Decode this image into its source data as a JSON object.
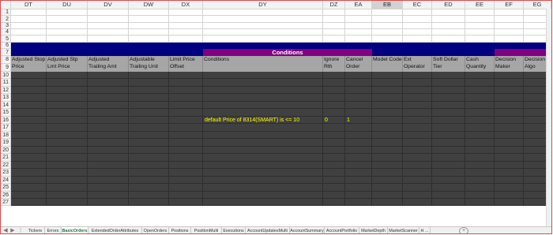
{
  "columns": [
    {
      "letter": "DT",
      "width": 45
    },
    {
      "letter": "DU",
      "width": 52
    },
    {
      "letter": "DV",
      "width": 52
    },
    {
      "letter": "DW",
      "width": 51
    },
    {
      "letter": "DX",
      "width": 43
    },
    {
      "letter": "DY",
      "width": 152
    },
    {
      "letter": "DZ",
      "width": 28
    },
    {
      "letter": "EA",
      "width": 34
    },
    {
      "letter": "EB",
      "width": 39
    },
    {
      "letter": "EC",
      "width": 37
    },
    {
      "letter": "ED",
      "width": 42
    },
    {
      "letter": "EE",
      "width": 37
    },
    {
      "letter": "EF",
      "width": 37
    },
    {
      "letter": "EG",
      "width": 35
    }
  ],
  "selected_column": "EB",
  "row_numbers": [
    "1",
    "2",
    "3",
    "4",
    "5",
    "6",
    "7",
    "8",
    "9",
    "10",
    "11",
    "12",
    "13",
    "14",
    "15",
    "16",
    "17",
    "18",
    "19",
    "20",
    "21",
    "22",
    "23",
    "24",
    "25",
    "26",
    "27"
  ],
  "group_label": "Conditions",
  "headers": [
    "Adjusted Stop Price",
    "Adjusted Stp Lmt Price",
    "Adjusted Trailing Amt",
    "Adjustable Trailing Unit",
    "Limit Price Offset",
    "Conditions",
    "Ignore Rth",
    "Cancel Order",
    "Model Code",
    "Ext Operator",
    "Soft Dollar Tier",
    "Cash Quantity",
    "Decision Maker",
    "Decision Algo"
  ],
  "data_row": {
    "condition": "default Price of 8314(SMART) is <= 10",
    "ignore_rth": "0",
    "cancel_order": "1"
  },
  "tabs": [
    {
      "label": "Tickers",
      "active": false
    },
    {
      "label": "Errors",
      "active": false
    },
    {
      "label": "BasicOrders",
      "active": true
    },
    {
      "label": "ExtendedOrderAttributes",
      "active": false
    },
    {
      "label": "OpenOrders",
      "active": false
    },
    {
      "label": "Positions",
      "active": false
    },
    {
      "label": "PositionMulti",
      "active": false
    },
    {
      "label": "Executions",
      "active": false
    },
    {
      "label": "AccountUpdatesMulti",
      "active": false
    },
    {
      "label": "AccountSummary",
      "active": false
    },
    {
      "label": "AccountPortfolio",
      "active": false
    },
    {
      "label": "MarketDepth",
      "active": false
    },
    {
      "label": "MarketScanner",
      "active": false
    },
    {
      "label": "H ...",
      "active": false
    }
  ],
  "nav_icons": {
    "prev": "◀",
    "next": "▶",
    "add": "+",
    "more": "⋮"
  },
  "colors": {
    "navy_band": "#000080",
    "group_purple": "#800080",
    "header_gray": "#a6a6a6",
    "data_dark": "#404040",
    "condition_text": "#ffff00",
    "active_tab": "#1d6f42"
  }
}
